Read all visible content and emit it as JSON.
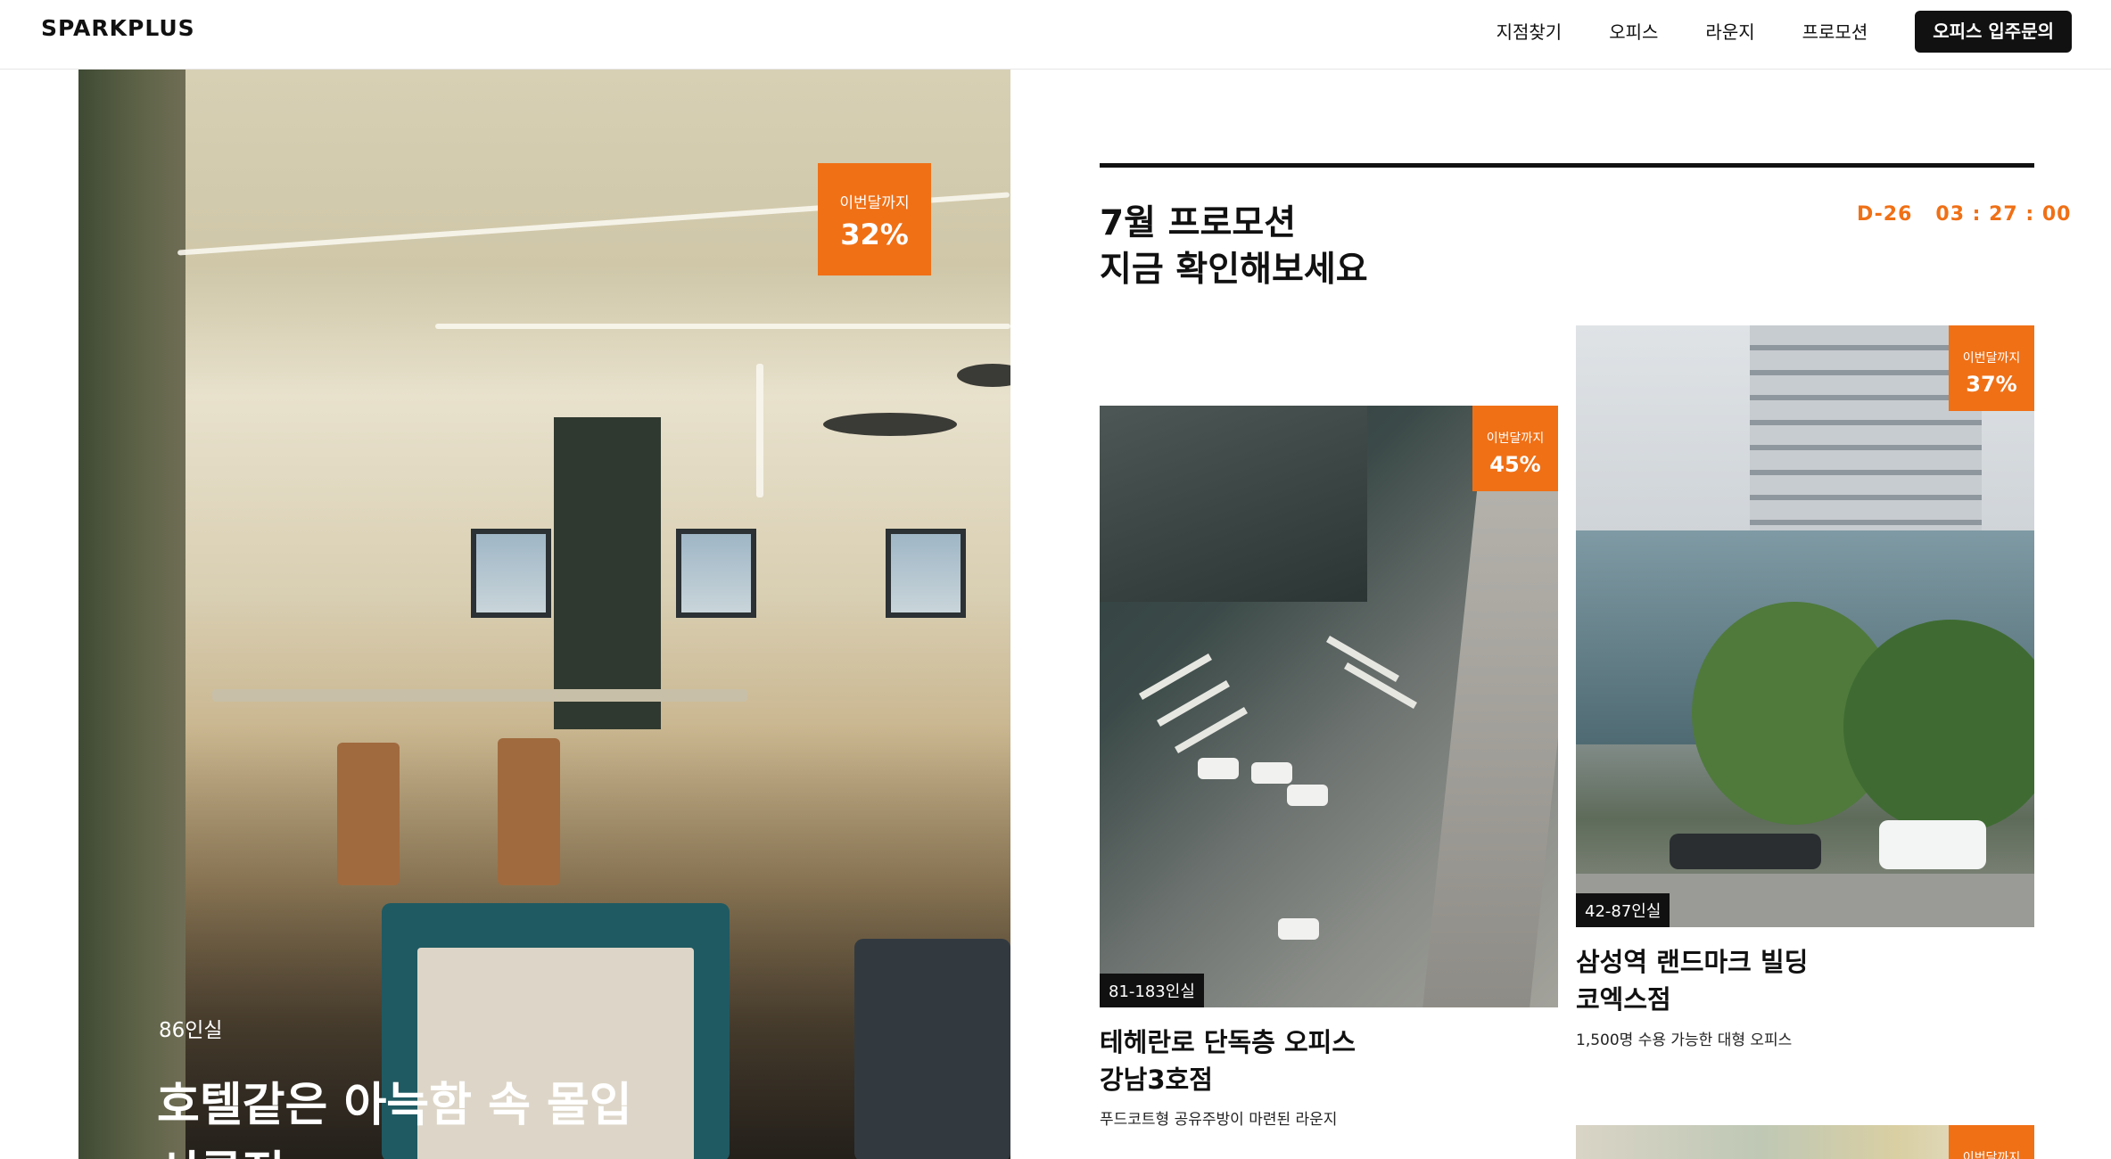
{
  "header": {
    "logo": "SPARKPLUS",
    "nav": [
      "지점찾기",
      "오피스",
      "라운지",
      "프로모션"
    ],
    "cta": "오피스 입주문의"
  },
  "hero": {
    "badge_label": "이번달까지",
    "badge_value": "32%",
    "capacity": "86인실",
    "title_line1": "호텔같은 아늑함 속 몰입",
    "title_line2": "선릉점"
  },
  "promo": {
    "title_line1": "7월 프로모션",
    "title_line2": "지금 확인해보세요",
    "countdown": "D-26   03 : 27 : 00"
  },
  "cards": [
    {
      "badge_label": "이번달까지",
      "badge_value": "45%",
      "capacity": "81-183인실",
      "title_line1": "테헤란로 단독층 오피스",
      "title_line2": "강남3호점",
      "desc": "푸드코트형 공유주방이 마련된 라운지"
    },
    {
      "badge_label": "이번달까지",
      "badge_value": "37%",
      "capacity": "42-87인실",
      "title_line1": "삼성역 랜드마크 빌딩",
      "title_line2": "코엑스점",
      "desc": "1,500명 수용 가능한 대형 오피스"
    },
    {
      "badge_label": "이번달까지"
    }
  ],
  "colors": {
    "accent": "#f07016",
    "dark": "#111111"
  }
}
